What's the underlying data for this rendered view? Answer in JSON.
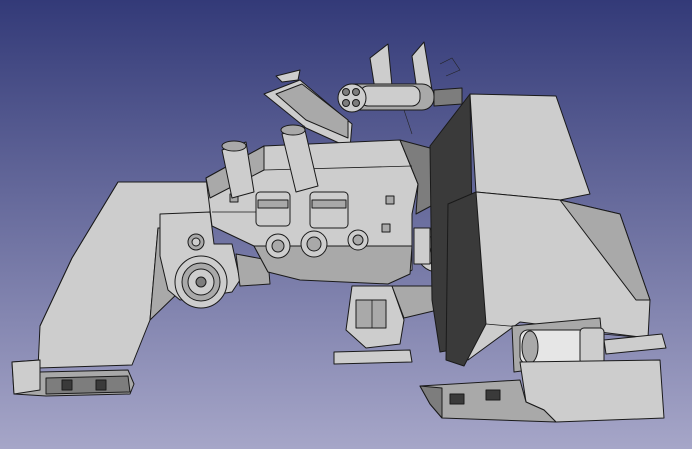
{
  "viewport": {
    "background_top": "#333a78",
    "background_bottom": "#a6a6c8",
    "model_color_light": "#cdcdcd",
    "model_color_shadow": "#3a3a3a"
  }
}
